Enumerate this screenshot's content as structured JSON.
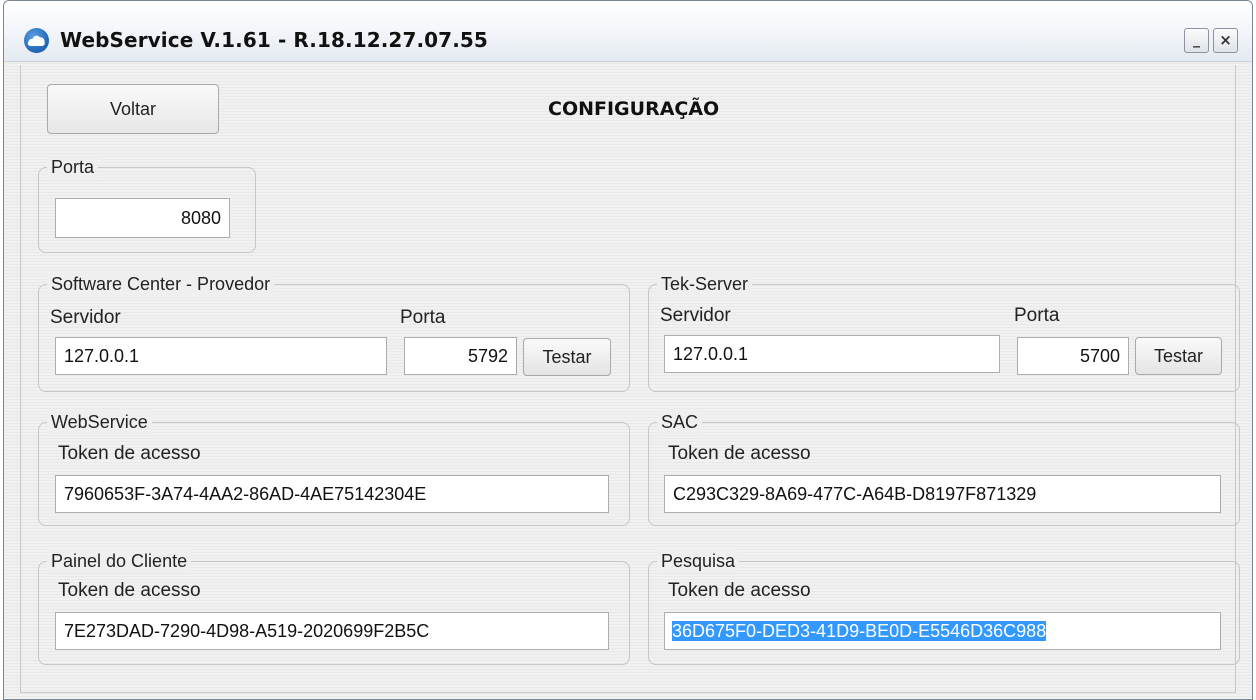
{
  "window": {
    "title": "WebService V.1.61 - R.18.12.27.07.55",
    "minimize_label": "_",
    "close_label": "×"
  },
  "header": {
    "back_label": "Voltar",
    "title": "CONFIGURAÇÃO"
  },
  "porta": {
    "legend": "Porta",
    "value": "8080"
  },
  "software_center": {
    "legend": "Software Center - Provedor",
    "server_label": "Servidor",
    "port_label": "Porta",
    "server_value": "127.0.0.1",
    "port_value": "5792",
    "test_label": "Testar"
  },
  "tek_server": {
    "legend": "Tek-Server",
    "server_label": "Servidor",
    "port_label": "Porta",
    "server_value": "127.0.0.1",
    "port_value": "5700",
    "test_label": "Testar"
  },
  "webservice": {
    "legend": "WebService",
    "token_label": "Token de acesso",
    "token_value": "7960653F-3A74-4AA2-86AD-4AE75142304E"
  },
  "sac": {
    "legend": "SAC",
    "token_label": "Token de acesso",
    "token_value": "C293C329-8A69-477C-A64B-D8197F871329"
  },
  "painel": {
    "legend": "Painel do Cliente",
    "token_label": "Token de acesso",
    "token_value": "7E273DAD-7290-4D98-A519-2020699F2B5C"
  },
  "pesquisa": {
    "legend": "Pesquisa",
    "token_label": "Token de acesso",
    "token_value": "36D675F0-DED3-41D9-BE0D-E5546D36C988"
  }
}
